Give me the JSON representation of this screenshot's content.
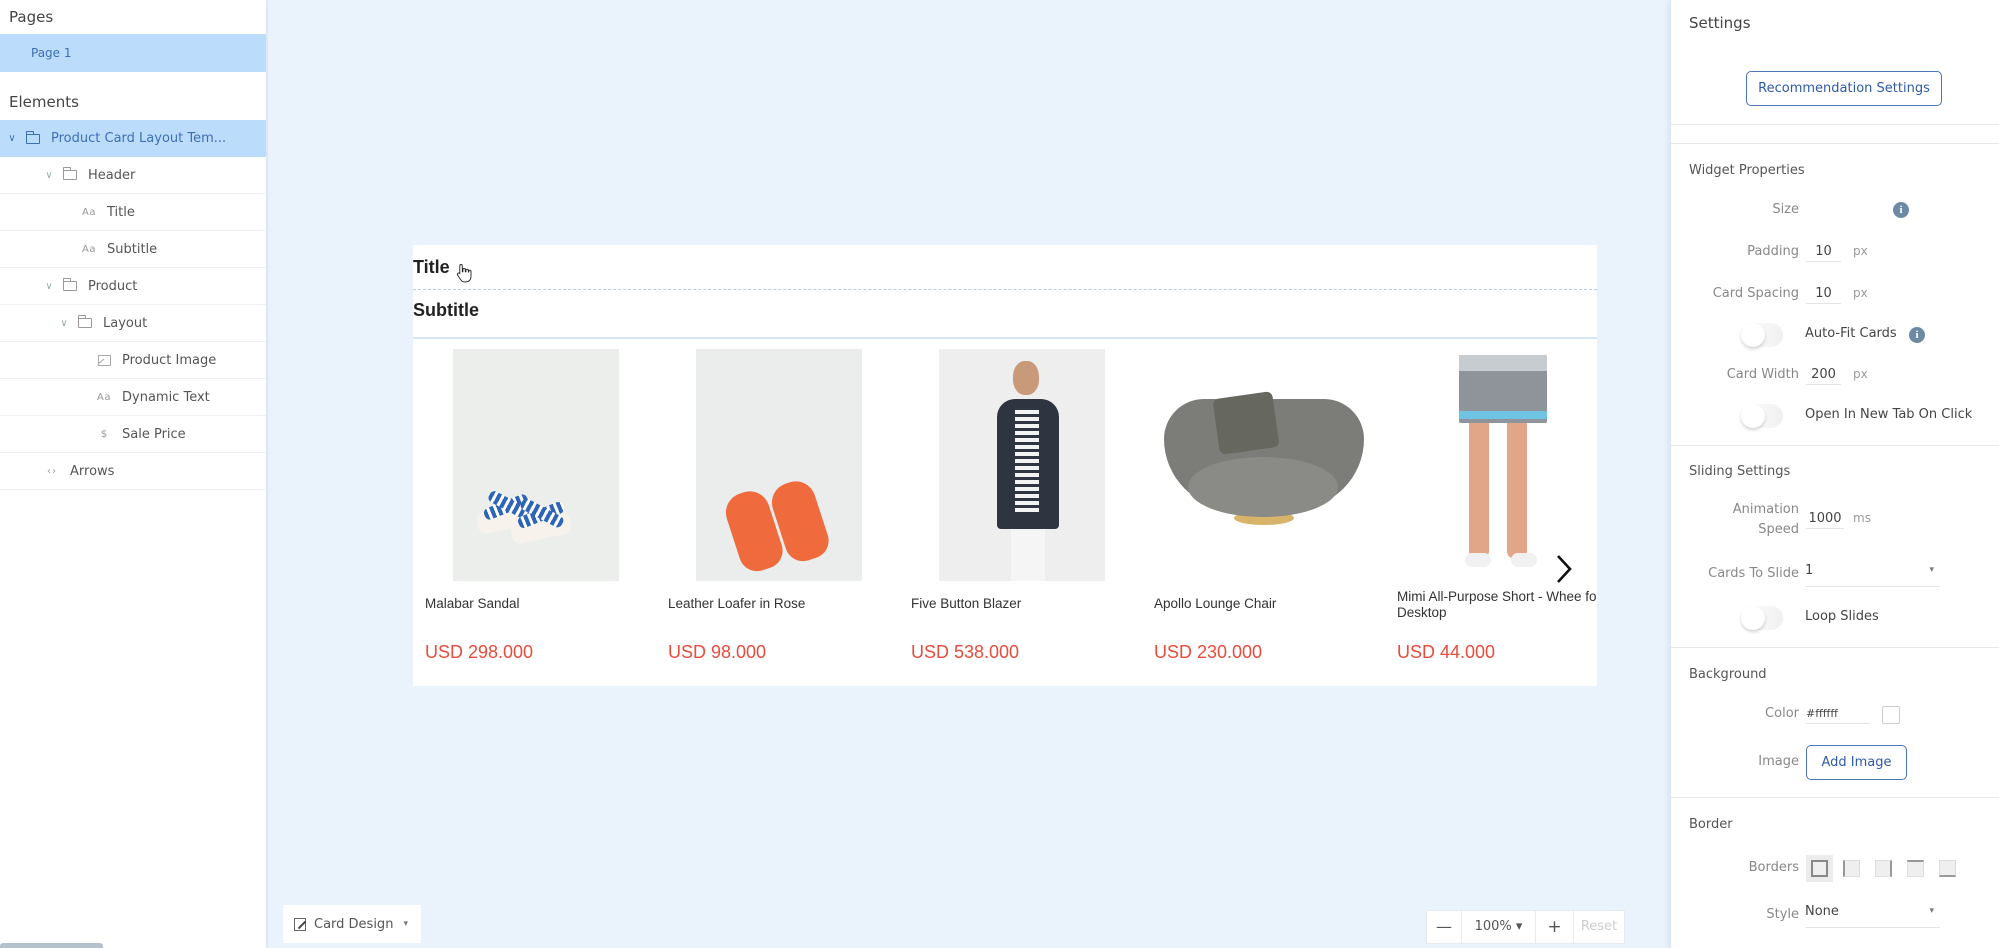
{
  "left_panel": {
    "pages_heading": "Pages",
    "pages": [
      {
        "label": "Page 1",
        "selected": true
      }
    ],
    "elements_heading": "Elements",
    "tree": [
      {
        "label": "Product Card Layout Tem...",
        "icon": "folder-icon",
        "expanded": true,
        "selected": true,
        "level": 0
      },
      {
        "label": "Header",
        "icon": "folder-icon",
        "expanded": true,
        "level": 1
      },
      {
        "label": "Title",
        "icon": "text-icon",
        "level": 2
      },
      {
        "label": "Subtitle",
        "icon": "text-icon",
        "level": 2
      },
      {
        "label": "Product",
        "icon": "folder-icon",
        "expanded": true,
        "level": 1
      },
      {
        "label": "Layout",
        "icon": "folder-icon",
        "expanded": true,
        "level": 2
      },
      {
        "label": "Product Image",
        "icon": "image-icon",
        "level": 3
      },
      {
        "label": "Dynamic Text",
        "icon": "text-icon",
        "level": 3
      },
      {
        "label": "Sale Price",
        "icon": "dollar-icon",
        "level": 3
      },
      {
        "label": "Arrows",
        "icon": "arrows-icon",
        "level": 1
      }
    ],
    "text_icon_glyph": "Aa",
    "dollar_glyph": "$",
    "arrows_glyph": "‹›",
    "chevron_glyph": "∨"
  },
  "canvas": {
    "widget": {
      "title": "Title",
      "subtitle": "Subtitle",
      "products": [
        {
          "name": "Malabar Sandal",
          "price": "USD 298.000",
          "image": "sandal"
        },
        {
          "name": "Leather Loafer in Rose",
          "price": "USD 98.000",
          "image": "loafer"
        },
        {
          "name": "Five Button Blazer",
          "price": "USD 538.000",
          "image": "blazer"
        },
        {
          "name": "Apollo Lounge Chair",
          "price": "USD 230.000",
          "image": "chair"
        },
        {
          "name": "Mimi All-Purpose Short - Whee fortune Desktop",
          "price": "USD 44.000",
          "image": "shorts"
        }
      ],
      "price_color": "#e74c3c"
    },
    "toolbar": {
      "card_design_label": "Card Design",
      "zoom_minus": "—",
      "zoom_value": "100% ▾",
      "zoom_plus": "+",
      "reset_label": "Reset"
    }
  },
  "settings": {
    "heading": "Settings",
    "recommendation_button": "Recommendation Settings",
    "widget_properties": {
      "heading": "Widget Properties",
      "size_label": "Size",
      "padding_label": "Padding",
      "padding_value": "10",
      "padding_unit": "px",
      "card_spacing_label": "Card Spacing",
      "card_spacing_value": "10",
      "card_spacing_unit": "px",
      "auto_fit_label": "Auto-Fit Cards",
      "auto_fit_on": false,
      "card_width_label": "Card Width",
      "card_width_value": "200",
      "card_width_unit": "px",
      "new_tab_label": "Open In New Tab On Click",
      "new_tab_on": false
    },
    "sliding": {
      "heading": "Sliding Settings",
      "animation_label_1": "Animation",
      "animation_label_2": "Speed",
      "animation_value": "1000",
      "animation_unit": "ms",
      "cards_to_slide_label": "Cards To Slide",
      "cards_to_slide_value": "1",
      "loop_label": "Loop Slides",
      "loop_on": false
    },
    "background": {
      "heading": "Background",
      "color_label": "Color",
      "color_value": "#ffffff",
      "image_label": "Image",
      "add_image_button": "Add Image"
    },
    "border": {
      "heading": "Border",
      "borders_label": "Borders",
      "border_options": [
        "all-borders",
        "left-border",
        "right-border",
        "top-border",
        "bottom-border"
      ],
      "selected_border": "all-borders",
      "style_label": "Style",
      "style_value": "None"
    },
    "info_glyph": "i",
    "select_caret": "▾"
  },
  "colors": {
    "accent": "#3e6fb4",
    "selection_bg": "#bcdcfb",
    "canvas_bg": "#eaf3fb"
  }
}
